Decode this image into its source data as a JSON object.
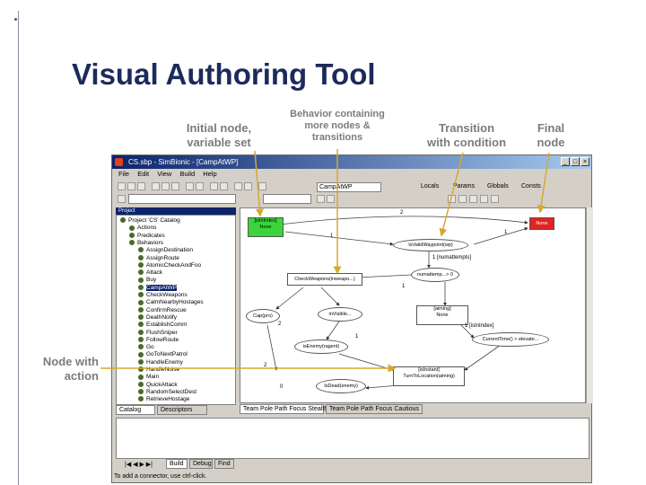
{
  "slide": {
    "title": "Visual Authoring Tool"
  },
  "callouts": {
    "initial_node": "Initial node,\nvariable set",
    "behavior": "Behavior containing\nmore nodes &\ntransitions",
    "transition": "Transition\nwith condition",
    "final_node": "Final\nnode",
    "node_action": "Node with\naction"
  },
  "app": {
    "window_title": "CS.sbp - SimBionic - [CampAtWP]",
    "menu": [
      "File",
      "Edit",
      "View",
      "Build",
      "Help"
    ],
    "toolbar": {
      "combo_value": "CampAtWP",
      "locals_label": "Locals",
      "params_label": "Params",
      "globals_label": "Globals",
      "consts_label": "Consts"
    },
    "tree": {
      "header": "Project",
      "rows": [
        {
          "label": "Project 'CS' Catalog",
          "indent": 0,
          "selected": false
        },
        {
          "label": "Actions",
          "indent": 1,
          "selected": false
        },
        {
          "label": "Predicates",
          "indent": 1,
          "selected": false
        },
        {
          "label": "Behaviors",
          "indent": 1,
          "selected": false
        },
        {
          "label": "AssignDestination",
          "indent": 2,
          "selected": false
        },
        {
          "label": "AssignRoute",
          "indent": 2,
          "selected": false
        },
        {
          "label": "AtomicCheckAndFoo",
          "indent": 2,
          "selected": false
        },
        {
          "label": "Attack",
          "indent": 2,
          "selected": false
        },
        {
          "label": "Buy",
          "indent": 2,
          "selected": false
        },
        {
          "label": "CampAtWP",
          "indent": 2,
          "selected": true
        },
        {
          "label": "CheckWeapons",
          "indent": 2,
          "selected": false
        },
        {
          "label": "CalmNearbyHostages",
          "indent": 2,
          "selected": false
        },
        {
          "label": "ConfirmRescue",
          "indent": 2,
          "selected": false
        },
        {
          "label": "DeathNotify",
          "indent": 2,
          "selected": false
        },
        {
          "label": "EstablishComm",
          "indent": 2,
          "selected": false
        },
        {
          "label": "FlushSniper",
          "indent": 2,
          "selected": false
        },
        {
          "label": "FollowRoute",
          "indent": 2,
          "selected": false
        },
        {
          "label": "Go",
          "indent": 2,
          "selected": false
        },
        {
          "label": "GoToNextPatrol",
          "indent": 2,
          "selected": false
        },
        {
          "label": "HandleEnemy",
          "indent": 2,
          "selected": false
        },
        {
          "label": "HandleNoise",
          "indent": 2,
          "selected": false
        },
        {
          "label": "Main",
          "indent": 2,
          "selected": false
        },
        {
          "label": "QuickAttack",
          "indent": 2,
          "selected": false
        },
        {
          "label": "RandomSelectDest",
          "indent": 2,
          "selected": false
        },
        {
          "label": "RetrieveHostage",
          "indent": 2,
          "selected": false
        }
      ]
    },
    "left_tabs": [
      "Catalog",
      "Descriptors"
    ],
    "canvas_tabs": [
      "Team Pole Path Focus Stealth",
      "Team Pole Path Focus Cautious"
    ],
    "output_tabs": [
      "Build",
      "Debug",
      "Find"
    ],
    "status": "To add a connector, use ctrl-click.",
    "nodes": {
      "initial": "[isInIndex]\nNone",
      "final": "None",
      "isvalidwaypoint": "IsValidWaypoint(wp)",
      "numattempts": "numattemp...> 0",
      "checkweapons": "CheckWeapons(inweapo...)",
      "cap": "Cap(pro)",
      "invisible": "inVisible...",
      "aiming": "[aiming]\nNone",
      "currenttime": "CurrentTime() > elevate...",
      "isenemy": "isEnemy(ragent)",
      "turnto": "[isInstant]\nTurnToLocation(aiming)",
      "isdead": "IsDead(enemy)"
    },
    "edges": {
      "e1": "1",
      "e2": "2",
      "e3": "1",
      "e4": "1 [numattempts]",
      "e5": "1",
      "e6": "1 [isInIndex]",
      "e7": "2",
      "e8": "1",
      "e9": "2",
      "e10": "0"
    }
  },
  "colors": {
    "title": "#1c2a5c",
    "callout_text": "#7c7c7c",
    "connector": "#d6a830",
    "initial_node": "#3cd43c",
    "final_node": "#e02424",
    "titlebar": "#0a246a"
  }
}
